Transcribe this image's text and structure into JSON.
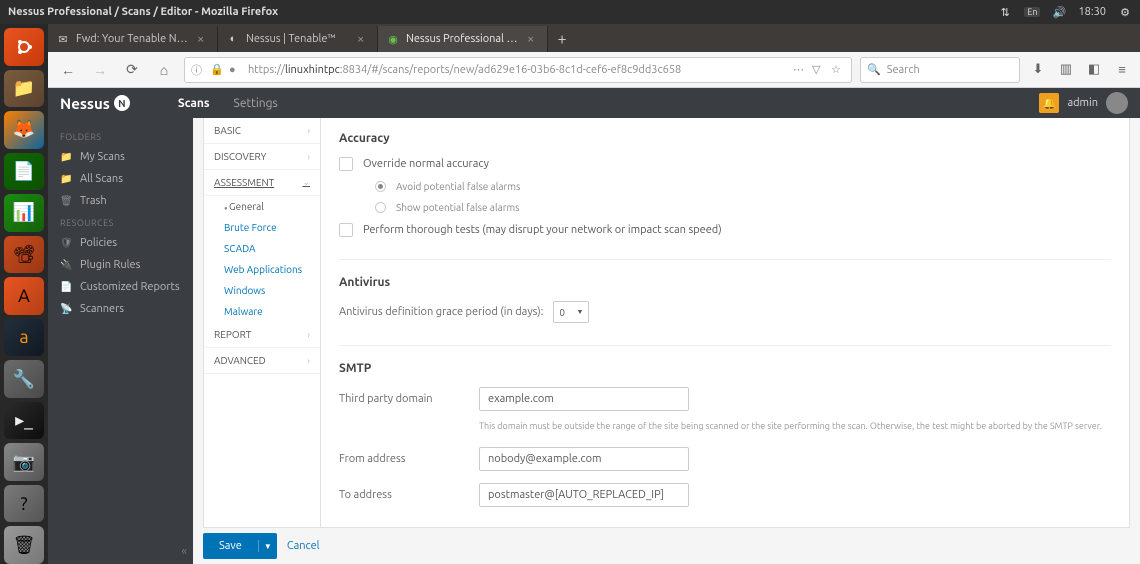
{
  "top_panel": {
    "title": "Nessus Professional / Scans / Editor - Mozilla Firefox",
    "lang": "En",
    "time": "18:30"
  },
  "tabs": [
    {
      "title": "Fwd: Your Tenable Ness…",
      "active": false
    },
    {
      "title": "Nessus | Tenable™",
      "active": false
    },
    {
      "title": "Nessus Professional / Sc",
      "active": true
    }
  ],
  "url": {
    "protocol": "https://",
    "host": "linuxhintpc",
    "path": ":8834/#/scans/reports/new/ad629e16-03b6-8c1d-cef6-ef8c9dd3c658",
    "search_placeholder": "Search"
  },
  "nessus": {
    "brand": "Nessus",
    "nav": {
      "scans": "Scans",
      "settings": "Settings"
    },
    "user": "admin"
  },
  "sidebar": {
    "folders_title": "FOLDERS",
    "folders": [
      "My Scans",
      "All Scans",
      "Trash"
    ],
    "resources_title": "RESOURCES",
    "resources": [
      "Policies",
      "Plugin Rules",
      "Customized Reports",
      "Scanners"
    ]
  },
  "settings_nav": {
    "basic": "BASIC",
    "discovery": "DISCOVERY",
    "assessment": "ASSESSMENT",
    "assessment_subs": {
      "general": "General",
      "brute": "Brute Force",
      "scada": "SCADA",
      "web": "Web Applications",
      "windows": "Windows",
      "malware": "Malware"
    },
    "report": "REPORT",
    "advanced": "ADVANCED"
  },
  "content": {
    "accuracy": {
      "title": "Accuracy",
      "override": "Override normal accuracy",
      "avoid": "Avoid potential false alarms",
      "show": "Show potential false alarms",
      "thorough": "Perform thorough tests (may disrupt your network or impact scan speed)"
    },
    "antivirus": {
      "title": "Antivirus",
      "grace_label": "Antivirus definition grace period (in days):",
      "grace_value": "0"
    },
    "smtp": {
      "title": "SMTP",
      "domain_label": "Third party domain",
      "domain_value": "example.com",
      "domain_hint": "This domain must be outside the range of the site being scanned or the site performing the scan. Otherwise, the test might be aborted by the SMTP server.",
      "from_label": "From address",
      "from_value": "nobody@example.com",
      "to_label": "To address",
      "to_value": "postmaster@[AUTO_REPLACED_IP]"
    }
  },
  "footer": {
    "save": "Save",
    "cancel": "Cancel"
  }
}
